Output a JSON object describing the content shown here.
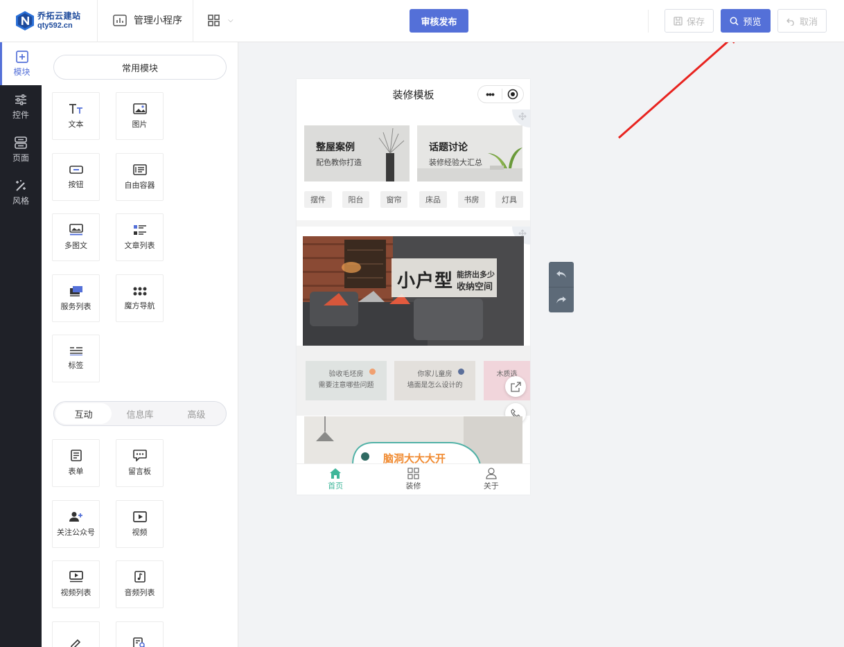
{
  "brand": {
    "name": "乔拓云建站",
    "url": "qty592.cn",
    "color": "#1d4a9b"
  },
  "header": {
    "manage_label": "管理小程序",
    "publish_label": "审核发布",
    "save_label": "保存",
    "preview_label": "预览",
    "cancel_label": "取消",
    "accent": "#5470d8"
  },
  "sidenav": [
    {
      "label": "模块",
      "icon": "plus-square-icon",
      "active": true
    },
    {
      "label": "控件",
      "icon": "sliders-icon"
    },
    {
      "label": "页面",
      "icon": "server-icon"
    },
    {
      "label": "风格",
      "icon": "magic-wand-icon"
    }
  ],
  "panel": {
    "common_title": "常用模块",
    "common_modules": [
      {
        "label": "文本",
        "icon": "text-icon"
      },
      {
        "label": "图片",
        "icon": "image-icon"
      },
      {
        "label": "按钮",
        "icon": "button-icon"
      },
      {
        "label": "自由容器",
        "icon": "container-icon"
      },
      {
        "label": "多图文",
        "icon": "multi-image-text-icon"
      },
      {
        "label": "文章列表",
        "icon": "article-list-icon"
      },
      {
        "label": "服务列表",
        "icon": "service-list-icon"
      },
      {
        "label": "魔方导航",
        "icon": "cube-nav-icon"
      },
      {
        "label": "标签",
        "icon": "tag-icon"
      }
    ],
    "tabs": [
      "互动",
      "信息库",
      "高级"
    ],
    "active_tab": 0,
    "interactive_modules": [
      {
        "label": "表单",
        "icon": "form-icon"
      },
      {
        "label": "留言板",
        "icon": "message-board-icon"
      },
      {
        "label": "关注公众号",
        "icon": "follow-account-icon"
      },
      {
        "label": "视频",
        "icon": "video-icon"
      },
      {
        "label": "视频列表",
        "icon": "video-list-icon"
      },
      {
        "label": "音频列表",
        "icon": "audio-list-icon"
      },
      {
        "label": "",
        "icon": "edit-icon"
      },
      {
        "label": "",
        "icon": "search-list-icon"
      }
    ]
  },
  "phone": {
    "title": "装修模板",
    "cards": [
      {
        "title": "整屋案例",
        "subtitle": "配色教你打造"
      },
      {
        "title": "话题讨论",
        "subtitle": "装修经验大汇总"
      }
    ],
    "chips": [
      "摆件",
      "阳台",
      "窗帘",
      "床品",
      "书房",
      "灯具"
    ],
    "banner": {
      "big": "小户型",
      "line1": "能挤出多少",
      "line2": "收纳空间"
    },
    "articles": [
      {
        "line1": "验收毛坯房",
        "line2": "需要注意哪些问题"
      },
      {
        "line1": "你家儿童房",
        "line2": "墙面是怎么设计的"
      },
      {
        "line1": "木质选",
        "line2": ""
      }
    ],
    "bottom_banner": "脑洞大大大开",
    "tabbar": [
      {
        "label": "首页",
        "icon": "home-icon",
        "active": true
      },
      {
        "label": "装修",
        "icon": "grid-icon"
      },
      {
        "label": "关于",
        "icon": "user-icon"
      }
    ],
    "tab_active_color": "#3fb69a"
  }
}
